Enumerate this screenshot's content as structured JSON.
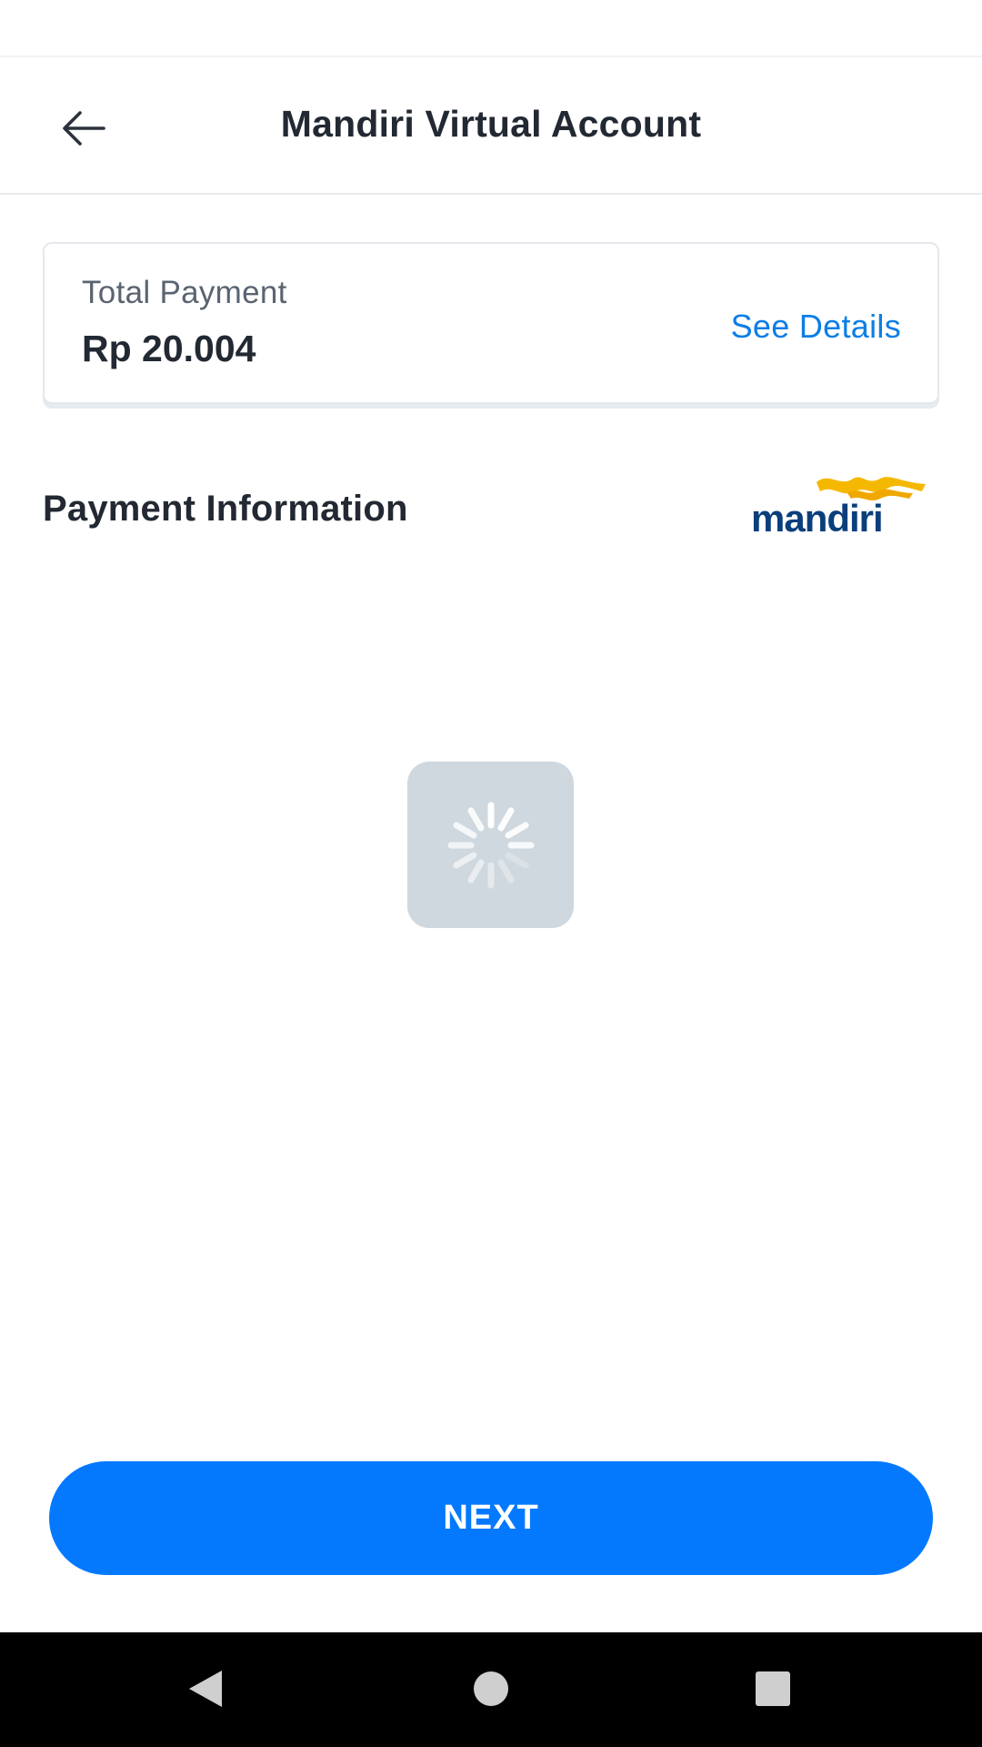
{
  "header": {
    "title": "Mandiri Virtual Account",
    "back_icon": "arrow-left-icon"
  },
  "payment_summary": {
    "label": "Total Payment",
    "amount": "Rp 20.004",
    "details_link": "See Details"
  },
  "payment_info": {
    "title": "Payment Information",
    "bank_logo": "mandiri",
    "loading_icon": "spinner-icon"
  },
  "actions": {
    "next_label": "NEXT"
  },
  "system_nav": {
    "back_icon": "triangle-back-icon",
    "home_icon": "circle-home-icon",
    "recents_icon": "square-recents-icon"
  },
  "colors": {
    "primary": "#0479fe",
    "link": "#0d7ee6",
    "text": "#222933",
    "muted": "#5a6471",
    "brand_blue": "#0a3f7c",
    "brand_yellow": "#f5b800",
    "loader_bg": "#cfd8df"
  }
}
